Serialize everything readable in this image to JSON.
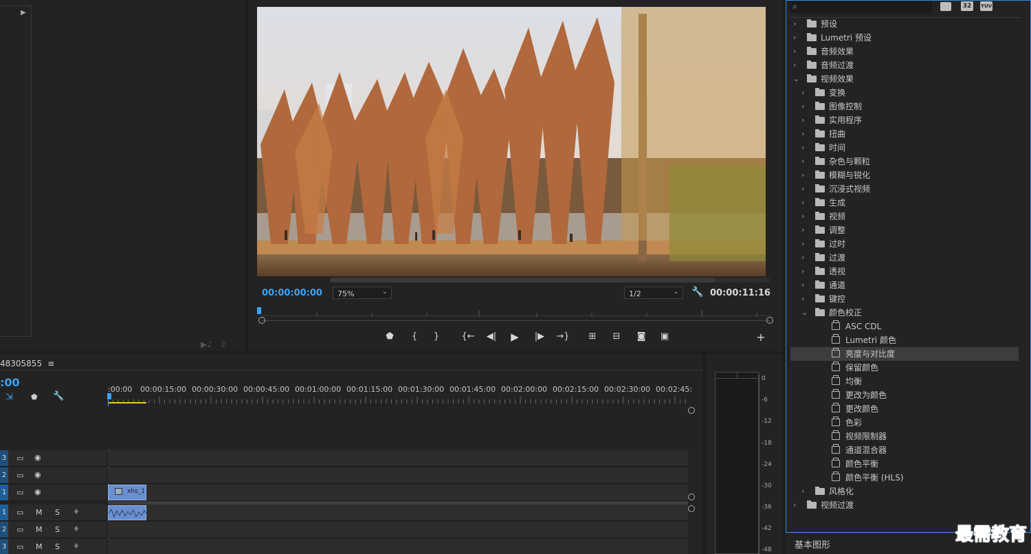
{
  "monitor": {
    "current_time": "00:00:00:00",
    "zoom": "75%",
    "resolution": "1/2",
    "duration": "00:00:11:16"
  },
  "timeline": {
    "sequence_name": "48305855",
    "playhead_time": ":00",
    "ruler": [
      ":00:00",
      "00:00:15:00",
      "00:00:30:00",
      "00:00:45:00",
      "00:01:00:00",
      "00:01:15:00",
      "00:01:30:00",
      "00:01:45:00",
      "00:02:00:00",
      "00:02:15:00",
      "00:02:30:00",
      "00:02:45:"
    ],
    "video_tracks": [
      {
        "num": "3"
      },
      {
        "num": "2"
      },
      {
        "num": "1"
      }
    ],
    "audio_tracks": [
      {
        "num": "1",
        "m": "M",
        "s": "S"
      },
      {
        "num": "2",
        "m": "M",
        "s": "S"
      },
      {
        "num": "3",
        "m": "M",
        "s": "S"
      }
    ],
    "clip_name": "xhs_1"
  },
  "meter": {
    "labels": [
      "0",
      "-6",
      "-12",
      "-18",
      "-24",
      "-30",
      "-36",
      "-42",
      "-48"
    ]
  },
  "effects": {
    "badges": [
      "32",
      "YUV"
    ],
    "tree": [
      {
        "label": "预设",
        "level": 0,
        "type": "preset"
      },
      {
        "label": "Lumetri 预设",
        "level": 0,
        "type": "preset"
      },
      {
        "label": "音频效果",
        "level": 0,
        "type": "folder"
      },
      {
        "label": "音频过渡",
        "level": 0,
        "type": "folder"
      },
      {
        "label": "视频效果",
        "level": 0,
        "type": "folder",
        "open": true
      },
      {
        "label": "变换",
        "level": 1,
        "type": "folder"
      },
      {
        "label": "图像控制",
        "level": 1,
        "type": "folder"
      },
      {
        "label": "实用程序",
        "level": 1,
        "type": "folder"
      },
      {
        "label": "扭曲",
        "level": 1,
        "type": "folder"
      },
      {
        "label": "时间",
        "level": 1,
        "type": "folder"
      },
      {
        "label": "杂色与颗粒",
        "level": 1,
        "type": "folder"
      },
      {
        "label": "模糊与锐化",
        "level": 1,
        "type": "folder"
      },
      {
        "label": "沉浸式视频",
        "level": 1,
        "type": "folder"
      },
      {
        "label": "生成",
        "level": 1,
        "type": "folder"
      },
      {
        "label": "视频",
        "level": 1,
        "type": "folder"
      },
      {
        "label": "调整",
        "level": 1,
        "type": "folder"
      },
      {
        "label": "过时",
        "level": 1,
        "type": "folder"
      },
      {
        "label": "过渡",
        "level": 1,
        "type": "folder"
      },
      {
        "label": "透视",
        "level": 1,
        "type": "folder"
      },
      {
        "label": "通道",
        "level": 1,
        "type": "folder"
      },
      {
        "label": "键控",
        "level": 1,
        "type": "folder"
      },
      {
        "label": "颜色校正",
        "level": 1,
        "type": "folder",
        "open": true
      },
      {
        "label": "ASC CDL",
        "level": 2,
        "type": "effect"
      },
      {
        "label": "Lumetri 颜色",
        "level": 2,
        "type": "effect"
      },
      {
        "label": "亮度与对比度",
        "level": 2,
        "type": "effect",
        "selected": true
      },
      {
        "label": "保留颜色",
        "level": 2,
        "type": "effect"
      },
      {
        "label": "均衡",
        "level": 2,
        "type": "effect"
      },
      {
        "label": "更改为颜色",
        "level": 2,
        "type": "effect"
      },
      {
        "label": "更改颜色",
        "level": 2,
        "type": "effect"
      },
      {
        "label": "色彩",
        "level": 2,
        "type": "effect"
      },
      {
        "label": "视频限制器",
        "level": 2,
        "type": "effect"
      },
      {
        "label": "通道混合器",
        "level": 2,
        "type": "effect"
      },
      {
        "label": "颜色平衡",
        "level": 2,
        "type": "effect"
      },
      {
        "label": "颜色平衡 (HLS)",
        "level": 2,
        "type": "effect"
      },
      {
        "label": "风格化",
        "level": 1,
        "type": "folder"
      },
      {
        "label": "视频过渡",
        "level": 0,
        "type": "folder"
      }
    ]
  },
  "bottom_panel": {
    "label": "基本图形"
  },
  "watermark": "最需教育",
  "colors": {
    "accent": "#2d8ceb",
    "timecode": "#3aa3f5",
    "clip": "#6a8fcf"
  }
}
